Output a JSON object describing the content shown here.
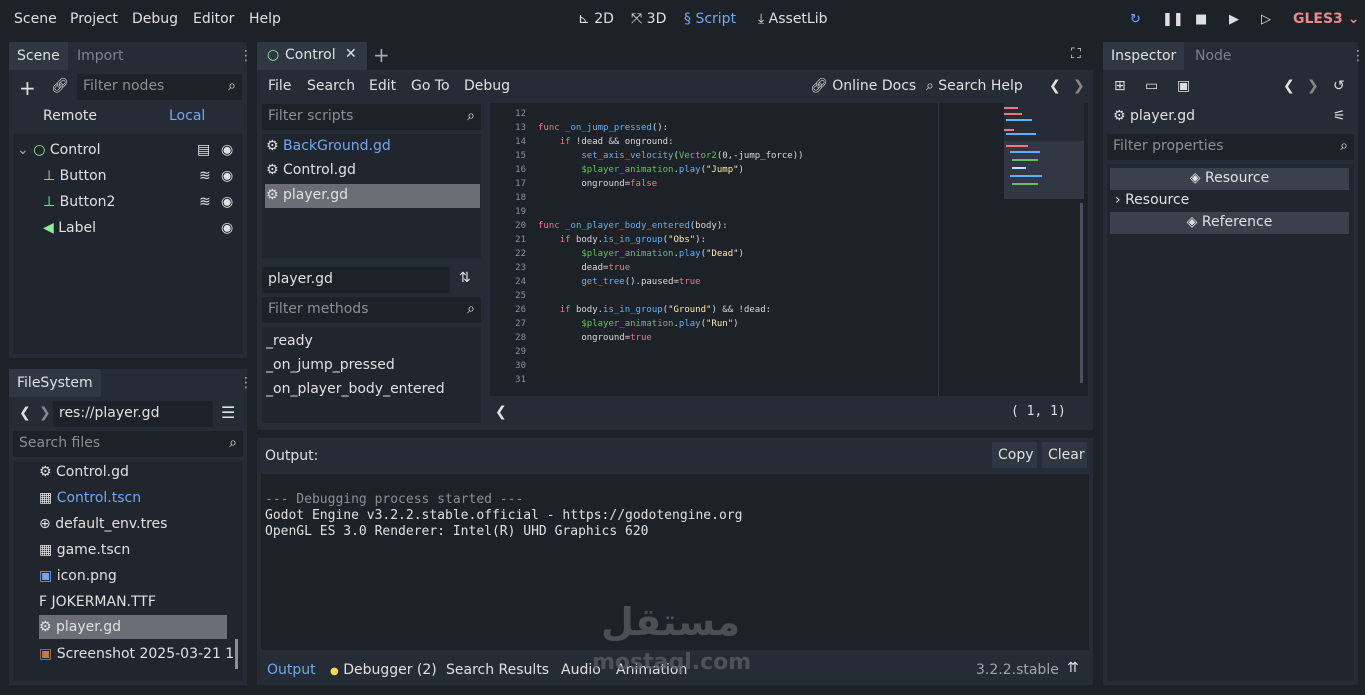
{
  "topbar": {
    "menus": [
      "Scene",
      "Project",
      "Debug",
      "Editor",
      "Help"
    ],
    "workspaces": {
      "w2d": "2D",
      "w3d": "3D",
      "script": "Script",
      "assetlib": "AssetLib"
    },
    "renderer": "GLES3"
  },
  "scene_dock": {
    "tabs": {
      "scene": "Scene",
      "import": "Import"
    },
    "filter_placeholder": "Filter nodes",
    "remote": "Remote",
    "local": "Local",
    "tree": [
      {
        "label": "Control"
      },
      {
        "label": "Button"
      },
      {
        "label": "Button2"
      },
      {
        "label": "Label"
      }
    ]
  },
  "filesystem_dock": {
    "tab": "FileSystem",
    "path": "res://player.gd",
    "search_placeholder": "Search files",
    "files": [
      {
        "label": "Control.gd",
        "icon": "gear-icon"
      },
      {
        "label": "Control.tscn",
        "icon": "clapper-icon"
      },
      {
        "label": "default_env.tres",
        "icon": "globe-icon"
      },
      {
        "label": "game.tscn",
        "icon": "clapper-icon"
      },
      {
        "label": "icon.png",
        "icon": "image-icon"
      },
      {
        "label": "JOKERMAN.TTF",
        "icon": "font-icon"
      },
      {
        "label": "player.gd",
        "icon": "gear-icon"
      },
      {
        "label": "Screenshot 2025-03-21 1",
        "icon": "image-icon"
      }
    ]
  },
  "editor_tabs": {
    "active": "Control"
  },
  "script_menu": {
    "items": [
      "File",
      "Search",
      "Edit",
      "Go To",
      "Debug"
    ],
    "online_docs": "Online Docs",
    "search_help": "Search Help"
  },
  "scripts_panel": {
    "filter_placeholder": "Filter scripts",
    "scripts": [
      "BackGround.gd",
      "Control.gd",
      "player.gd"
    ],
    "current": "player.gd",
    "methods_placeholder": "Filter methods",
    "methods": [
      "_ready",
      "_on_jump_pressed",
      "_on_player_body_entered"
    ]
  },
  "code": {
    "lines": [
      {
        "n": "12",
        "t": ""
      },
      {
        "n": "13",
        "t": "func _on_jump_pressed():"
      },
      {
        "n": "14",
        "t": "    if !dead && onground:"
      },
      {
        "n": "15",
        "t": "        set_axis_velocity(Vector2(0,-jump_force))"
      },
      {
        "n": "16",
        "t": "        $player_animation.play(\"Jump\")"
      },
      {
        "n": "17",
        "t": "        onground=false"
      },
      {
        "n": "18",
        "t": ""
      },
      {
        "n": "19",
        "t": ""
      },
      {
        "n": "20",
        "t": "func _on_player_body_entered(body):"
      },
      {
        "n": "21",
        "t": "    if body.is_in_group(\"Obs\"):"
      },
      {
        "n": "22",
        "t": "        $player_animation.play(\"Dead\")"
      },
      {
        "n": "23",
        "t": "        dead=true"
      },
      {
        "n": "24",
        "t": "        get_tree().paused=true"
      },
      {
        "n": "25",
        "t": ""
      },
      {
        "n": "26",
        "t": "    if body.is_in_group(\"Ground\") && !dead:"
      },
      {
        "n": "27",
        "t": "        $player_animation.play(\"Run\")"
      },
      {
        "n": "28",
        "t": "        onground=true"
      },
      {
        "n": "29",
        "t": ""
      },
      {
        "n": "30",
        "t": ""
      },
      {
        "n": "31",
        "t": ""
      }
    ],
    "cursor": "(   1,   1)"
  },
  "output": {
    "title": "Output:",
    "copy": "Copy",
    "clear": "Clear",
    "lines": [
      "--- Debugging process started ---",
      "Godot Engine v3.2.2.stable.official - https://godotengine.org",
      "OpenGL ES 3.0 Renderer: Intel(R) UHD Graphics 620"
    ]
  },
  "bottom_tabs": {
    "output": "Output",
    "debugger": "Debugger (2)",
    "search_results": "Search Results",
    "audio": "Audio",
    "animation": "Animation",
    "version": "3.2.2.stable"
  },
  "watermark": {
    "arabic": "مستقل",
    "latin": "mostaql.com"
  },
  "inspector": {
    "tabs": {
      "inspector": "Inspector",
      "node": "Node"
    },
    "object": "player.gd",
    "filter_placeholder": "Filter properties",
    "section1": "Resource",
    "row": "Resource",
    "section2": "Reference"
  },
  "colors": {
    "accent": "#6fa8ef",
    "bg": "#1d2229",
    "panel": "#262c35",
    "renderer": "#e88a8a"
  }
}
